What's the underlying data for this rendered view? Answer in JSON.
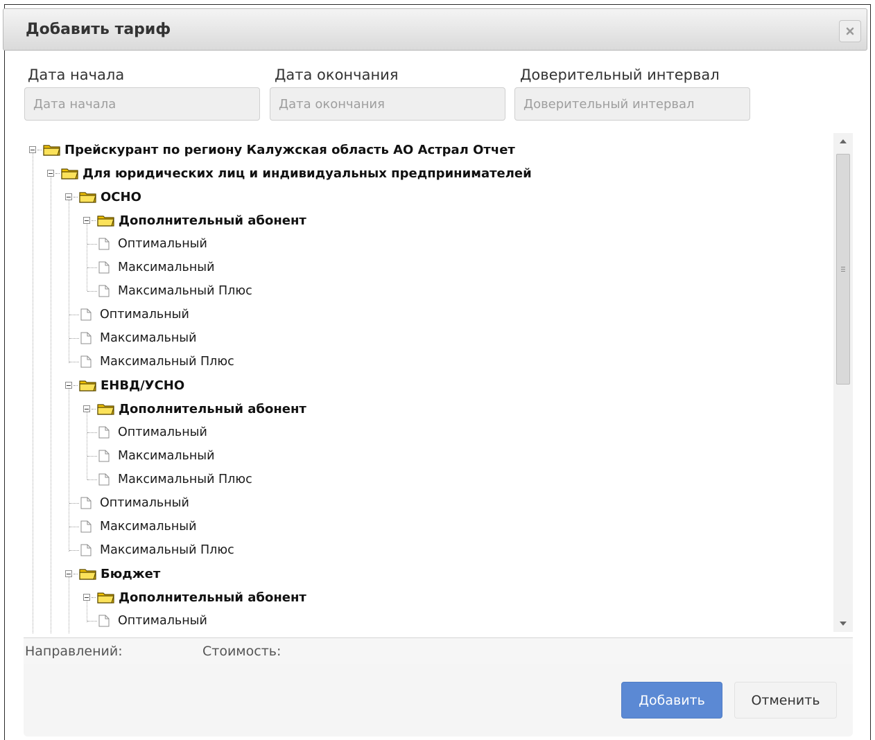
{
  "dialog": {
    "title": "Добавить тариф",
    "close_icon": "close-icon"
  },
  "fields": {
    "start": {
      "label": "Дата начала",
      "placeholder": "Дата начала",
      "value": ""
    },
    "end": {
      "label": "Дата окончания",
      "placeholder": "Дата окончания",
      "value": ""
    },
    "interval": {
      "label": "Доверительный интервал",
      "placeholder": "Доверительный интервал",
      "value": ""
    }
  },
  "tree": {
    "root": "Прейскурант по региону Калужская область АО Астрал Отчет",
    "legal": "Для юридических лиц и индивидуальных предпринимателей",
    "osno": {
      "label": "ОСНО",
      "extra": {
        "label": "Дополнительный абонент",
        "items": [
          "Оптимальный",
          "Максимальный",
          "Максимальный Плюс"
        ]
      },
      "items": [
        "Оптимальный",
        "Максимальный",
        "Максимальный Плюс"
      ]
    },
    "envd": {
      "label": "ЕНВД/УСНО",
      "extra": {
        "label": "Дополнительный абонент",
        "items": [
          "Оптимальный",
          "Максимальный",
          "Максимальный Плюс"
        ]
      },
      "items": [
        "Оптимальный",
        "Максимальный",
        "Максимальный Плюс"
      ]
    },
    "budget": {
      "label": "Бюджет",
      "extra": {
        "label": "Дополнительный абонент",
        "items": [
          "Оптимальный"
        ]
      }
    }
  },
  "summary": {
    "directions_label": "Направлений:",
    "cost_label": "Стоимость:"
  },
  "buttons": {
    "add": "Добавить",
    "cancel": "Отменить"
  },
  "colors": {
    "primary_button": "#5b89d4",
    "folder": "#f2c200",
    "titlebar": "#e4e4e4"
  }
}
